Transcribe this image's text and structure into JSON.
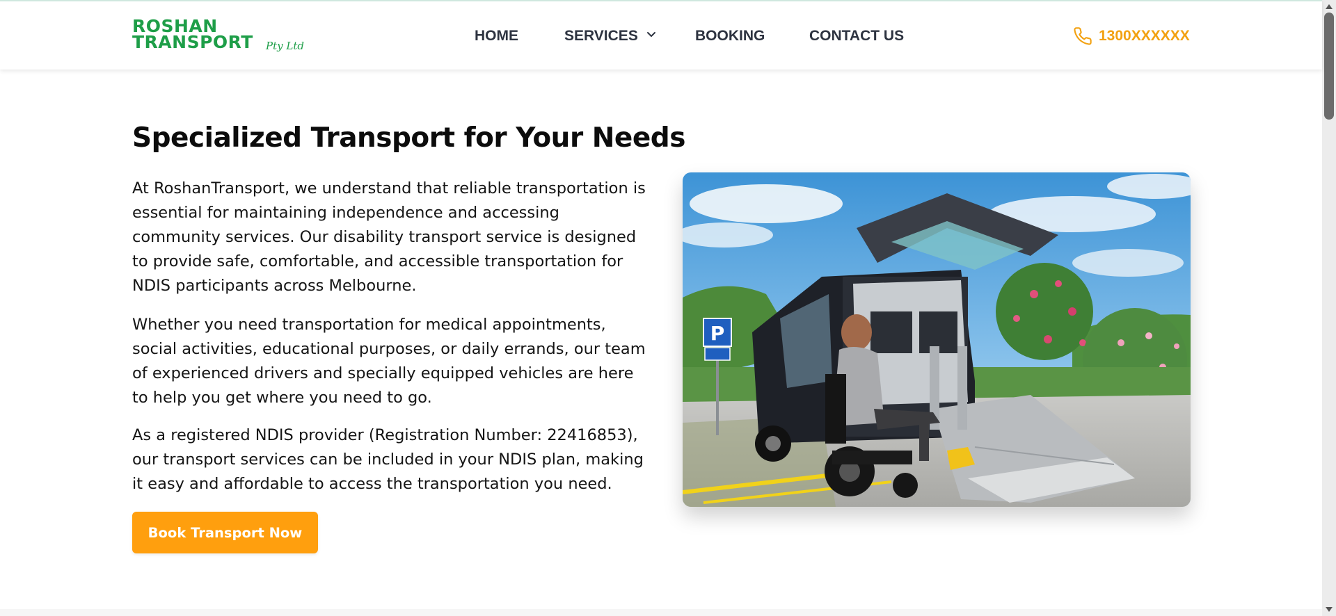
{
  "brand": {
    "logo_line1": "ROSHAN",
    "logo_line2": "TRANSPORT",
    "logo_sub": "Pty Ltd",
    "color": "#1e9e48"
  },
  "nav": {
    "items": [
      {
        "label": "HOME"
      },
      {
        "label": "SERVICES",
        "has_dropdown": true
      },
      {
        "label": "BOOKING"
      },
      {
        "label": "CONTACT US"
      }
    ]
  },
  "contact": {
    "phone": "1300XXXXXX",
    "icon": "phone-icon",
    "color": "#f2a111"
  },
  "main": {
    "title": "Specialized Transport for Your Needs",
    "paragraphs": [
      "At RoshanTransport, we understand that reliable transportation is essential for maintaining independence and accessing community services. Our disability transport service is designed to provide safe, comfortable, and accessible transportation for NDIS participants across Melbourne.",
      "Whether you need transportation for medical appointments, social activities, educational purposes, or daily errands, our team of experienced drivers and specially equipped vehicles are here to help you get where you need to go.",
      "As a registered NDIS provider (Registration Number: 22416853), our transport services can be included in your NDIS plan, making it easy and affordable to access the transportation you need."
    ],
    "cta_label": "Book Transport Now",
    "cta_color": "#ff9f0e"
  },
  "photo": {
    "parking_sign": "P"
  }
}
